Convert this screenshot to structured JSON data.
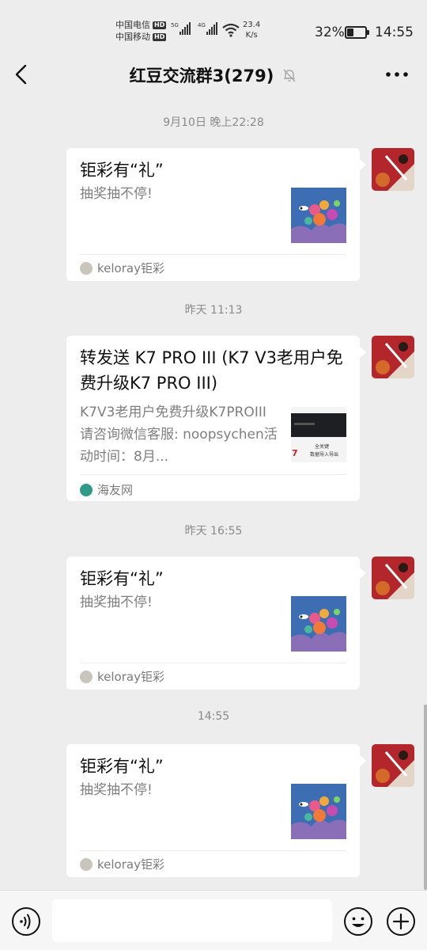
{
  "status_bar": {
    "carrier_1": "中国电信",
    "carrier_2": "中国移动",
    "hd_badge": "HD",
    "sig_label_1": "5G",
    "sig_label_2": "4G",
    "net_speed_value": "23.4",
    "net_speed_unit": "K/s",
    "battery_percent": "32%",
    "battery_level": 0.32,
    "time": "14:55"
  },
  "header": {
    "back_icon": "chevron-left-icon",
    "title": "红豆交流群3(279)",
    "mute_icon": "bell-muted-icon",
    "more_icon": "more-dots-icon"
  },
  "messages": [
    {
      "timestamp": "9月10日 晚上22:28",
      "title": "钜彩有“礼”",
      "desc": "抽奖抽不停!",
      "source": "keloray钜彩"
    },
    {
      "timestamp": "昨天 11:13",
      "title": "转发送 K7 PRO III (K7 V3老用户免费升级K7 PRO III)",
      "desc": "K7V3老用户免费升级K7PROIII请咨询微信客服: noopsychen活动时间：8月...",
      "source": "海友网",
      "thumb_text_1": "全关键",
      "thumb_text_2": "数据导入导出"
    },
    {
      "timestamp": "昨天 16:55",
      "title": "钜彩有“礼”",
      "desc": "抽奖抽不停!",
      "source": "keloray钜彩"
    },
    {
      "timestamp": "14:55",
      "title": "钜彩有“礼”",
      "desc": "抽奖抽不停!",
      "source": "keloray钜彩"
    }
  ],
  "input_bar": {
    "voice_icon": "voice-icon",
    "input_value": "",
    "emoji_icon": "emoji-icon",
    "plus_icon": "plus-icon"
  },
  "colors": {
    "background": "#ededed",
    "card": "#ffffff",
    "timestamp_text": "#8a8a8a",
    "avatar_red": "#b3262c"
  }
}
